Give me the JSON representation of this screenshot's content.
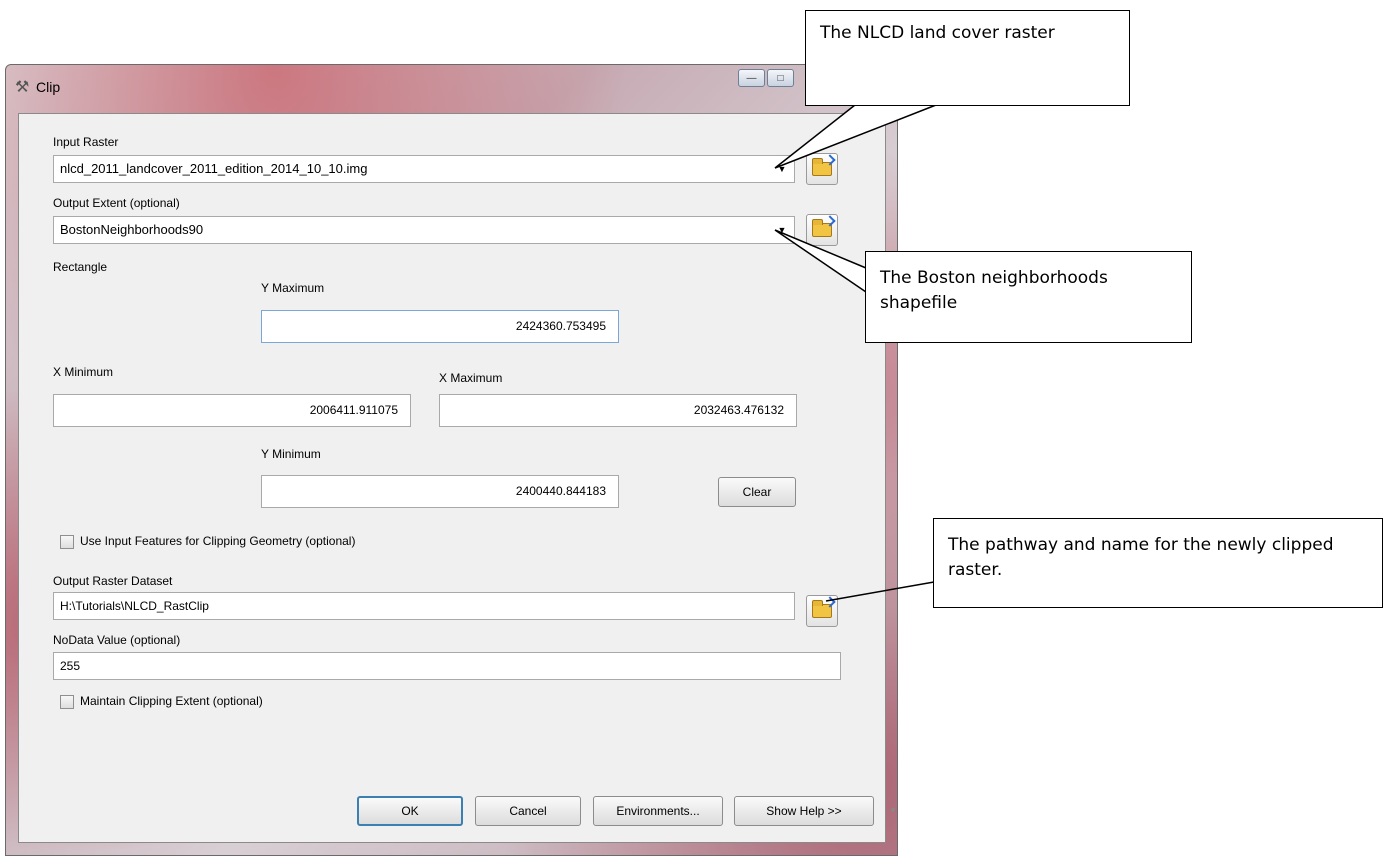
{
  "window": {
    "title": "Clip",
    "controls": {
      "minimize": "—",
      "maximize": "□"
    }
  },
  "form": {
    "input_raster": {
      "label": "Input Raster",
      "value": "nlcd_2011_landcover_2011_edition_2014_10_10.img"
    },
    "output_extent": {
      "label": "Output Extent (optional)",
      "value": "BostonNeighborhoods90"
    },
    "rectangle": {
      "label": "Rectangle",
      "y_max": {
        "label": "Y Maximum",
        "value": "2424360.753495"
      },
      "x_min": {
        "label": "X Minimum",
        "value": "2006411.911075"
      },
      "x_max": {
        "label": "X Maximum",
        "value": "2032463.476132"
      },
      "y_min": {
        "label": "Y Minimum",
        "value": "2400440.844183"
      },
      "clear_label": "Clear"
    },
    "use_input_features": {
      "label": "Use Input Features for Clipping Geometry (optional)",
      "checked": false
    },
    "output_raster": {
      "label": "Output Raster Dataset",
      "value": "H:\\Tutorials\\NLCD_RastClip"
    },
    "nodata": {
      "label": "NoData Value (optional)",
      "value": "255"
    },
    "maintain_extent": {
      "label": "Maintain Clipping Extent (optional)",
      "checked": false
    }
  },
  "buttons": {
    "ok": "OK",
    "cancel": "Cancel",
    "environments": "Environments...",
    "show_help": "Show Help >>"
  },
  "callouts": {
    "nlcd": "The NLCD land cover raster",
    "boston": "The Boston neighborhoods shapefile",
    "output": "The pathway and name for the newly clipped raster."
  },
  "colors": {
    "callout_border": "#000000",
    "dialog_background": "#f0f0f0",
    "default_button_border": "#3c7fb1"
  }
}
